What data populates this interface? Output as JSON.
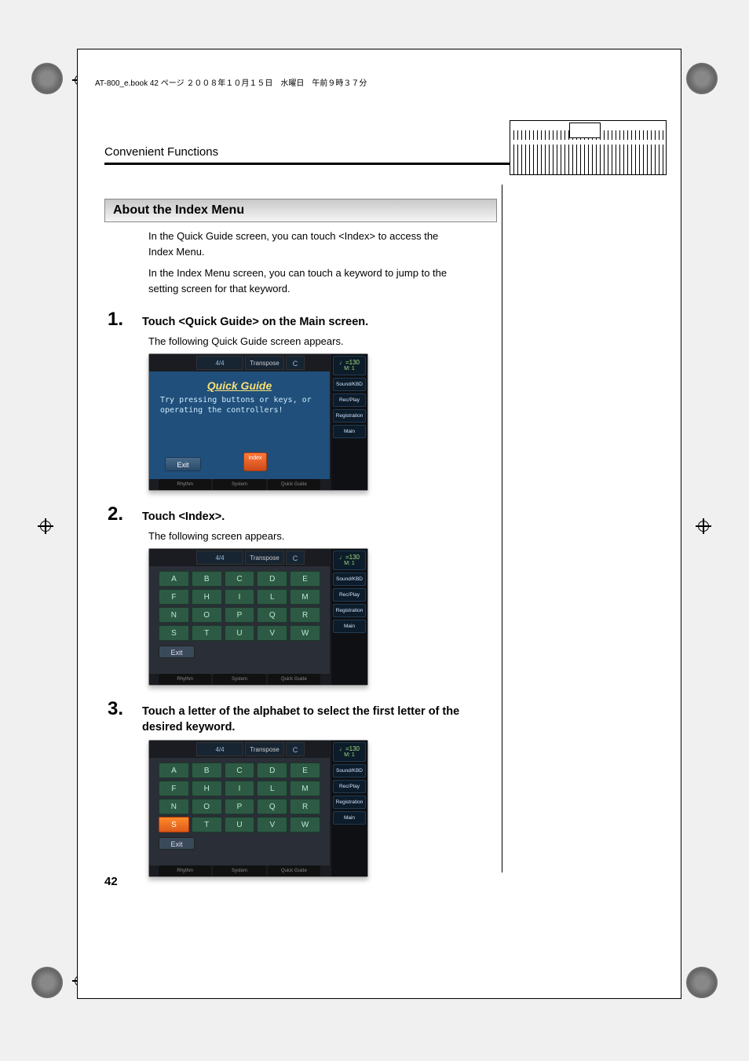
{
  "running_head": "AT-800_e.book 42 ページ ２００８年１０月１５日　水曜日　午前９時３７分",
  "header_title": "Convenient Functions",
  "subhead": "About the Index Menu",
  "intro": {
    "p1": "In the Quick Guide screen, you can touch <Index> to access the Index Menu.",
    "p2": "In the Index Menu screen, you can touch a keyword to jump to the setting screen for that keyword."
  },
  "steps": {
    "s1": {
      "num": "1.",
      "title": "Touch <Quick Guide> on the Main screen.",
      "sub": "The following Quick Guide screen appears."
    },
    "s2": {
      "num": "2.",
      "title": "Touch <Index>.",
      "sub": "The following screen appears."
    },
    "s3": {
      "num": "3.",
      "title": "Touch a letter of the alphabet to select the first letter of the desired keyword."
    }
  },
  "shot_common": {
    "time_sig": "4/4",
    "transpose_label": "Transpose",
    "transpose_value": "C",
    "tempo": "♩=130",
    "meter": "M:   1",
    "side": {
      "sound": "Sound/KBD",
      "rec": "Rec/Play",
      "reg": "Registration",
      "main": "Main"
    },
    "bottom": {
      "rhythm": "Rhythm",
      "system": "System",
      "quick": "Quick Guide"
    },
    "exit": "Exit",
    "index": "Index"
  },
  "shot1": {
    "title": "Quick Guide",
    "body": "Try pressing buttons or keys, or operating the controllers!"
  },
  "letters": [
    "A",
    "B",
    "C",
    "D",
    "E",
    "F",
    "H",
    "I",
    "L",
    "M",
    "N",
    "O",
    "P",
    "Q",
    "R",
    "S",
    "T",
    "U",
    "V",
    "W"
  ],
  "page_number": "42"
}
